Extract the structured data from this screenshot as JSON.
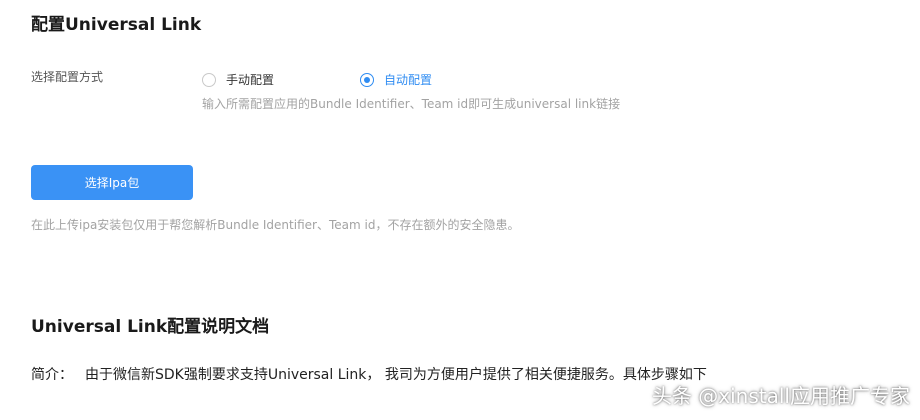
{
  "section1": {
    "title": "配置Universal Link",
    "config_label": "选择配置方式",
    "options": [
      {
        "label": "手动配置",
        "selected": false
      },
      {
        "label": "自动配置",
        "selected": true
      }
    ],
    "auto_hint": "输入所需配置应用的Bundle Identifier、Team id即可生成universal link链接",
    "select_button": "选择Ipa包",
    "upload_hint": "在此上传ipa安装包仅用于帮您解析Bundle Identifier、Team id，不存在额外的安全隐患。"
  },
  "section2": {
    "title": "Universal Link配置说明文档",
    "intro_label": "简介：",
    "intro_text": "由于微信新SDK强制要求支持Universal Link， 我司为方便用户提供了相关便捷服务。具体步骤如下"
  },
  "watermark": "头条 @xinstall应用推广专家",
  "colors": {
    "accent": "#2f8cf2",
    "button": "#3a92f5",
    "hint": "#a3a3a3"
  }
}
